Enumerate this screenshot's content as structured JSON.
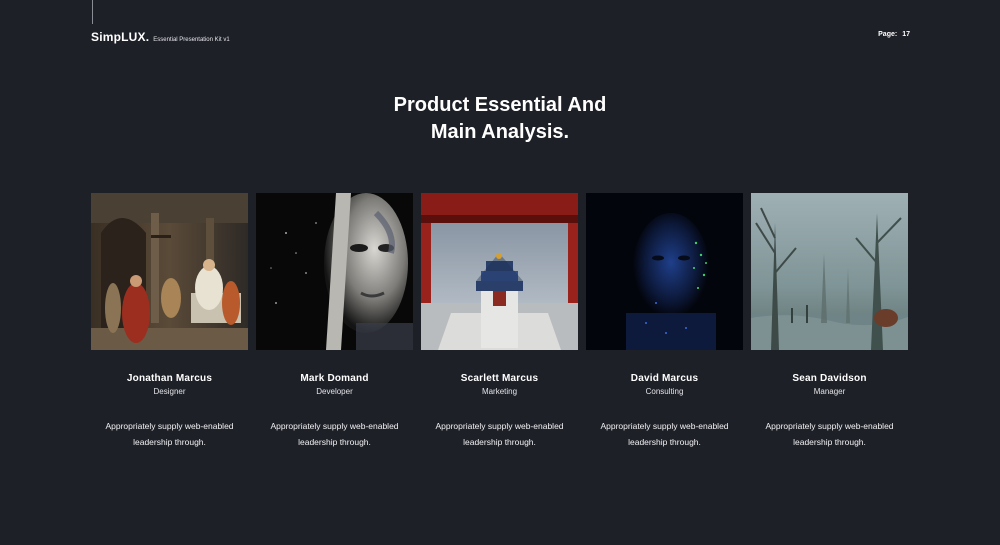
{
  "header": {
    "brand": "SimpLUX.",
    "subtitle": "Essential Presentation Kit v1",
    "page_label": "Page:",
    "page_number": "17"
  },
  "main": {
    "title_line1": "Product Essential And",
    "title_line2": "Main Analysis."
  },
  "team": [
    {
      "name": "Jonathan Marcus",
      "role": "Designer",
      "description": "Appropriately supply web-enabled leadership through."
    },
    {
      "name": "Mark Domand",
      "role": "Developer",
      "description": "Appropriately supply web-enabled leadership through."
    },
    {
      "name": "Scarlett Marcus",
      "role": "Marketing",
      "description": "Appropriately supply web-enabled leadership through."
    },
    {
      "name": "David Marcus",
      "role": "Consulting",
      "description": "Appropriately supply web-enabled leadership through."
    },
    {
      "name": "Sean Davidson",
      "role": "Manager",
      "description": "Appropriately supply web-enabled leadership through."
    }
  ],
  "colors": {
    "background": "#1e2028",
    "text": "#ffffff"
  }
}
